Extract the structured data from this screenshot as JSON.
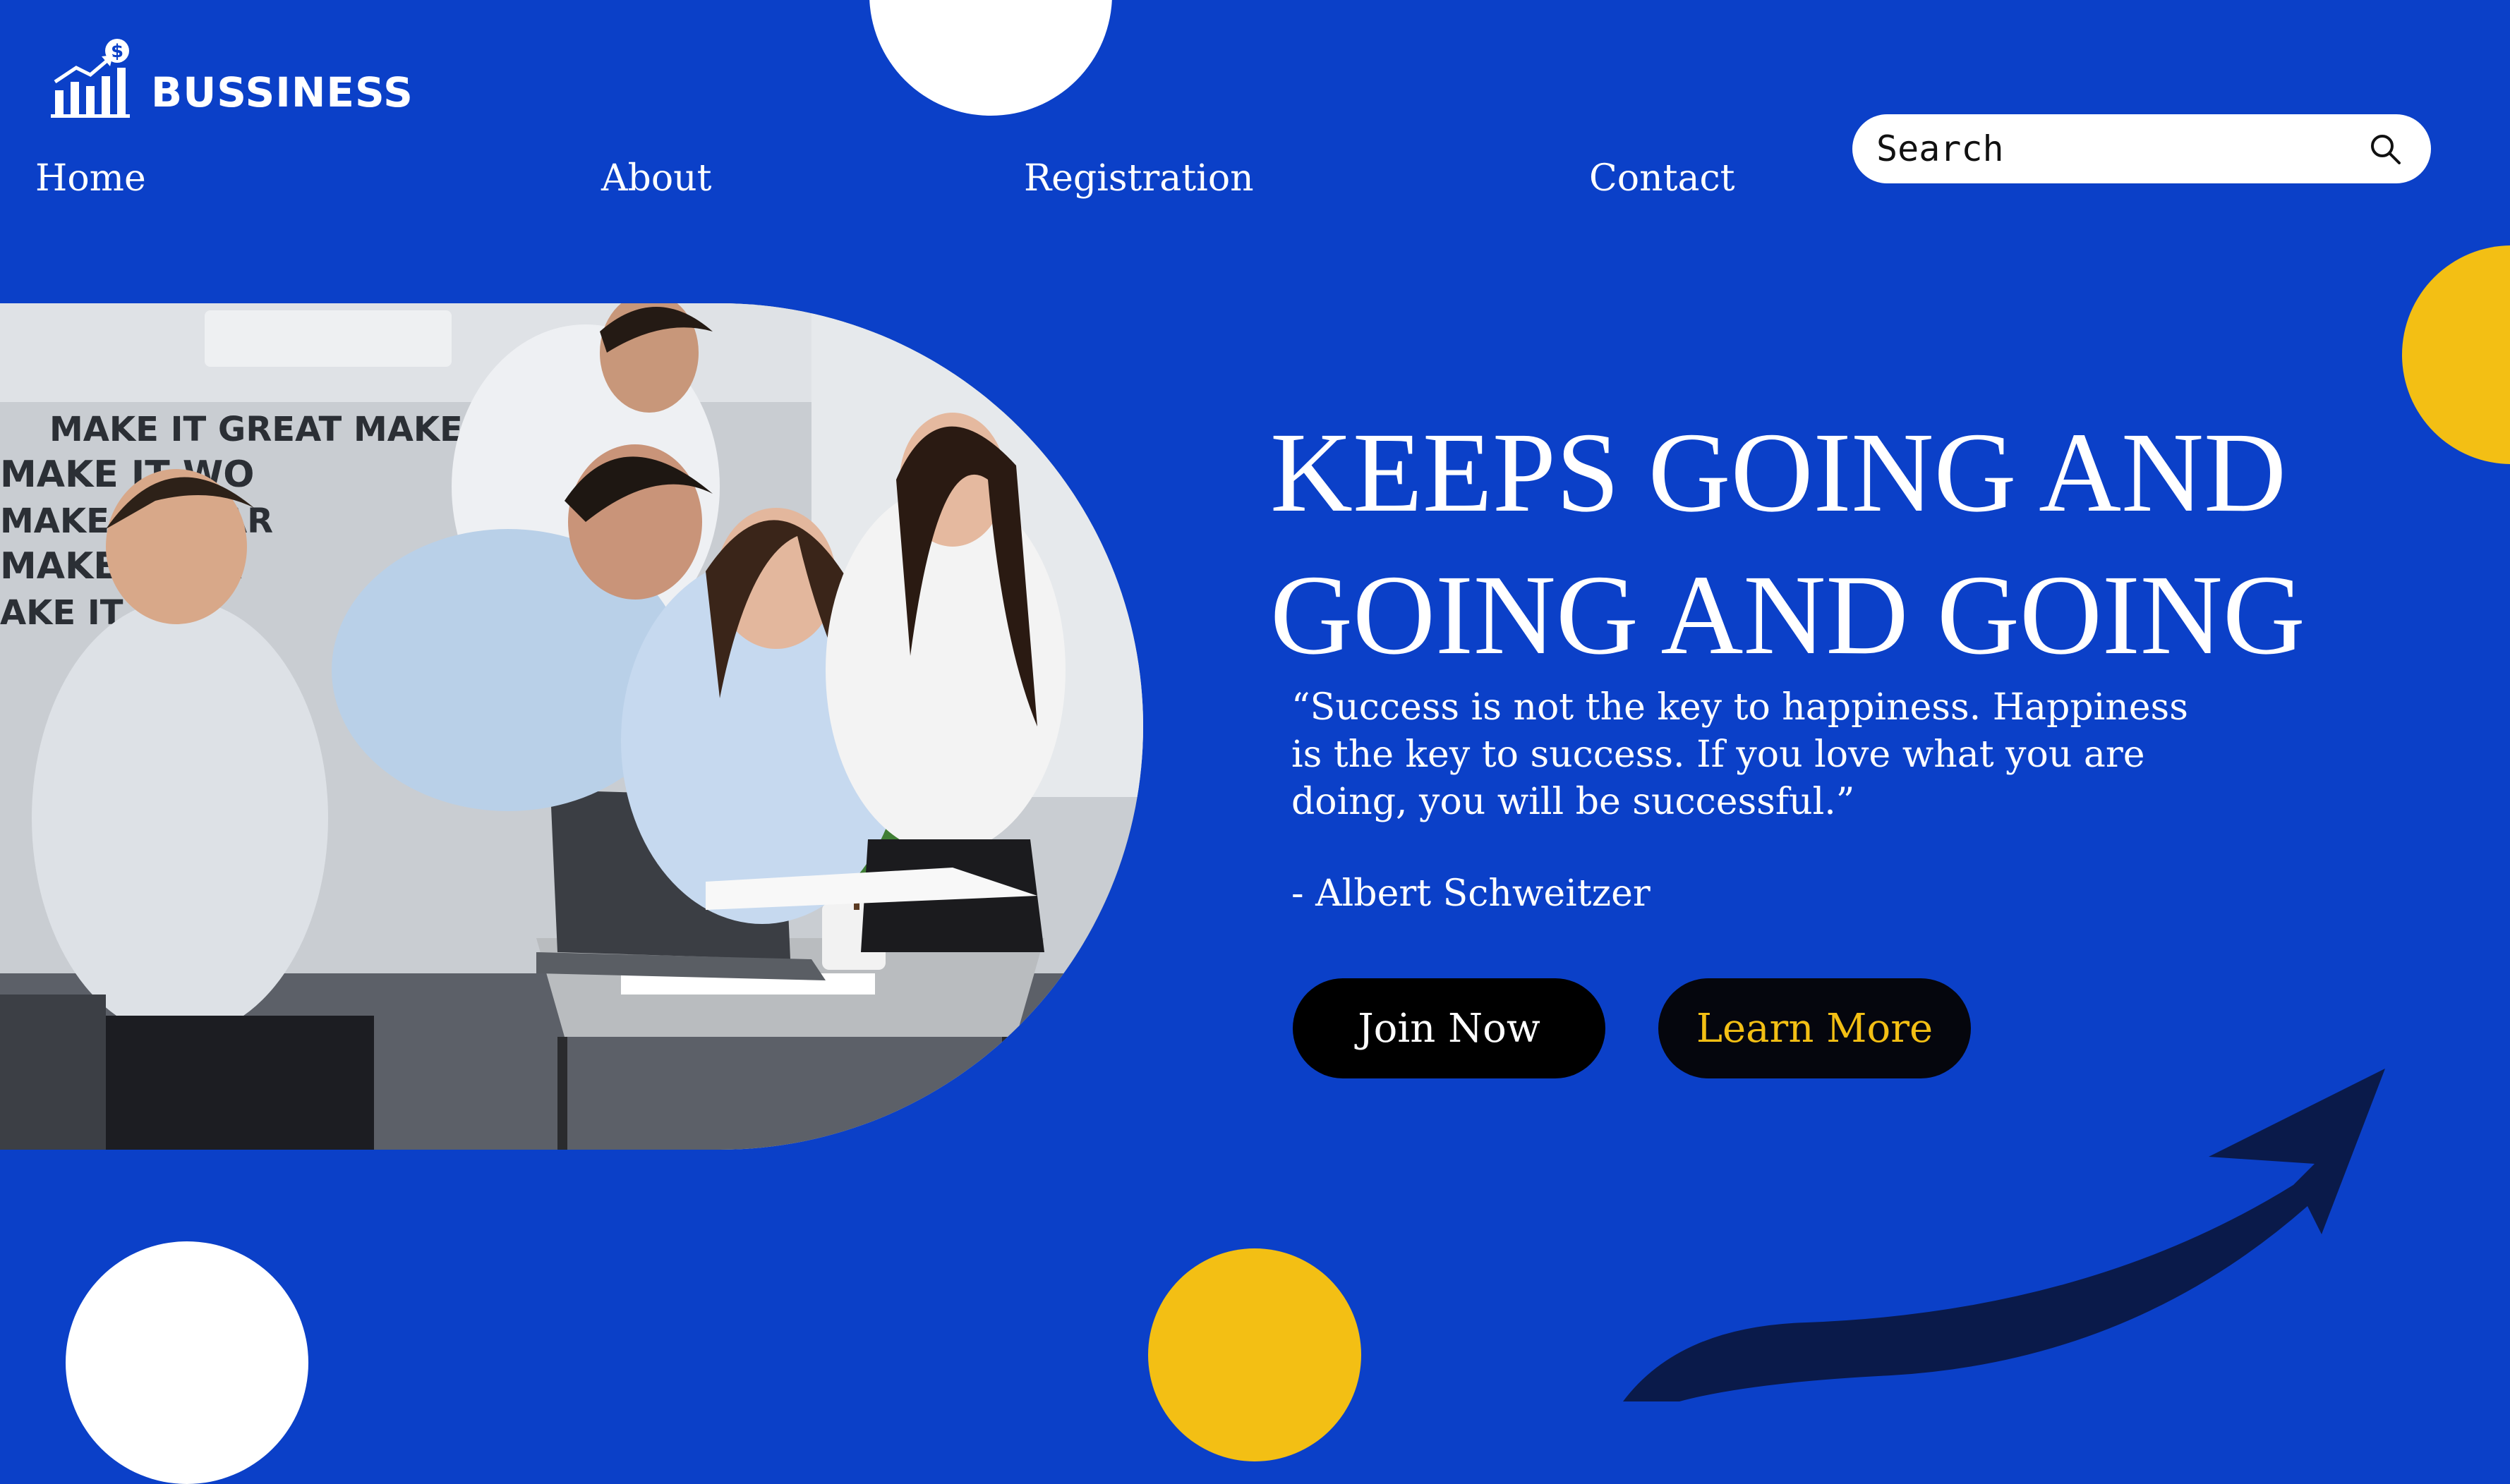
{
  "brand": {
    "name": "BUSSINESS",
    "logo_icon": "bar-chart-dollar-icon"
  },
  "nav": [
    {
      "label": "Home"
    },
    {
      "label": "About"
    },
    {
      "label": "Registration"
    },
    {
      "label": "Contact"
    }
  ],
  "search": {
    "placeholder": "Search",
    "icon": "search-icon"
  },
  "hero": {
    "headline_line1": "KEEPS GOING AND",
    "headline_line2": "GOING AND GOING",
    "quote": "“Success is not the key to happiness. Happiness is the key to success. If you love what you are doing, you will be successful.”",
    "author": "- Albert Schweitzer",
    "join_label": "Join Now",
    "learn_label": "Learn More",
    "photo_wall_text": [
      "MAKE IT GREAT MAKE",
      "MAKE IT WO",
      "MAKE IT SOAR",
      "MAKE IT HA",
      "AKE IT R"
    ]
  },
  "colors": {
    "background": "#0b40c8",
    "accent_yellow": "#f3bf14",
    "white": "#ffffff",
    "button": "#000000",
    "arrow": "#0a1a4a"
  }
}
